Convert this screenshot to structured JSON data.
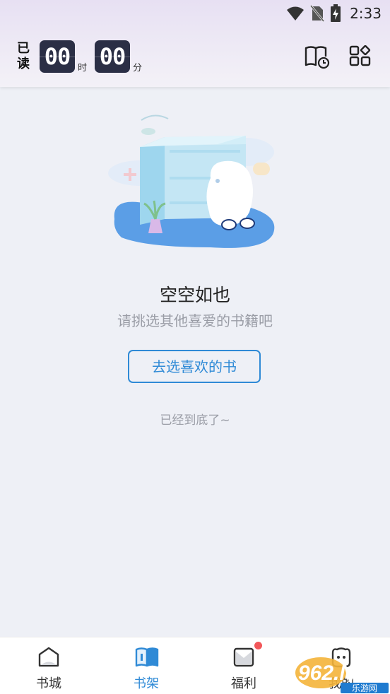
{
  "status_bar": {
    "time": "2:33",
    "icons": [
      "wifi-icon",
      "no-sim-icon",
      "battery-charging-icon"
    ]
  },
  "header": {
    "read_label": "已读",
    "hours": "00",
    "hours_unit": "时",
    "minutes": "00",
    "minutes_unit": "分",
    "icons": [
      "reading-history-icon",
      "grid-menu-icon"
    ]
  },
  "empty_state": {
    "title": "空空如也",
    "subtitle": "请挑选其他喜爱的书籍吧",
    "button_label": "去选喜欢的书",
    "end_text": "已经到底了~"
  },
  "tabs": [
    {
      "label": "书城",
      "icon": "bookstore-icon",
      "active": false
    },
    {
      "label": "书架",
      "icon": "bookshelf-icon",
      "active": true
    },
    {
      "label": "福利",
      "icon": "welfare-icon",
      "active": false,
      "badge": true
    },
    {
      "label": "我的",
      "icon": "profile-icon",
      "active": false
    }
  ],
  "watermark": {
    "text": "962.NET",
    "subtext": "乐游网"
  },
  "colors": {
    "accent": "#2f8ad6",
    "badge": "#f2575a",
    "timer_bg": "#2b2f45",
    "background": "#eef0f6"
  }
}
